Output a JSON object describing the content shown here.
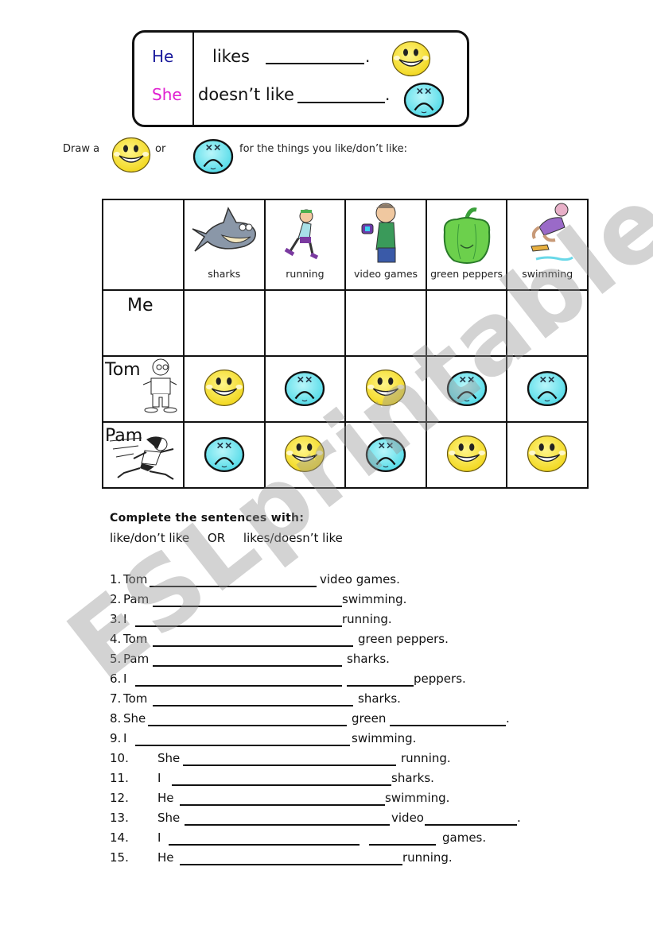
{
  "rule_box": {
    "he": "He",
    "she": "She",
    "likes": "likes",
    "doesnt_like": "doesn’t like",
    "period": ".",
    "he_color": "#1a1a9c",
    "she_color": "#e020d0"
  },
  "instruction": {
    "part1": "Draw a",
    "part2": "or",
    "part3": "for the things you like/don’t like:"
  },
  "table": {
    "activities": [
      "sharks",
      "running",
      "video games",
      "green peppers",
      "swimming"
    ],
    "rows": [
      {
        "name": "Me",
        "faces": [
          "",
          "",
          "",
          "",
          ""
        ]
      },
      {
        "name": "Tom",
        "faces": [
          "happy",
          "sad",
          "happy",
          "sad",
          "sad"
        ]
      },
      {
        "name": "Pam",
        "faces": [
          "sad",
          "happy",
          "sad",
          "happy",
          "happy"
        ]
      }
    ]
  },
  "colors": {
    "happy_face": "#f7e43a",
    "sad_face": "#6fe6f0",
    "ink": "#111111"
  },
  "task": {
    "title": "Complete the sentences with:",
    "option1": "like/don’t like",
    "or": "OR",
    "option2": "likes/doesn’t like"
  },
  "sentences": [
    {
      "num": "1.",
      "subject": "Tom",
      "end": "video games."
    },
    {
      "num": "2.",
      "subject": "Pam",
      "end": "swimming."
    },
    {
      "num": "3.",
      "subject": "I",
      "end": "running."
    },
    {
      "num": "4.",
      "subject": "Tom",
      "end": "green peppers."
    },
    {
      "num": "5.",
      "subject": "Pam",
      "end": "sharks."
    },
    {
      "num": "6.",
      "subject": "I",
      "end": "peppers."
    },
    {
      "num": "7.",
      "subject": "Tom",
      "end": "sharks."
    },
    {
      "num": "8.",
      "subject": "She",
      "mid": "green",
      "end": "."
    },
    {
      "num": "9.",
      "subject": "I",
      "end": "swimming."
    },
    {
      "num": "10.",
      "subject": "She",
      "end": "running."
    },
    {
      "num": "11.",
      "subject": "I",
      "end": "sharks."
    },
    {
      "num": "12.",
      "subject": "He",
      "end": "swimming."
    },
    {
      "num": "13.",
      "subject": "She",
      "mid": "video",
      "end": "."
    },
    {
      "num": "14.",
      "subject": "I",
      "end": "games."
    },
    {
      "num": "15.",
      "subject": "He",
      "end": "running."
    }
  ],
  "watermark": "ESLprintables.com"
}
